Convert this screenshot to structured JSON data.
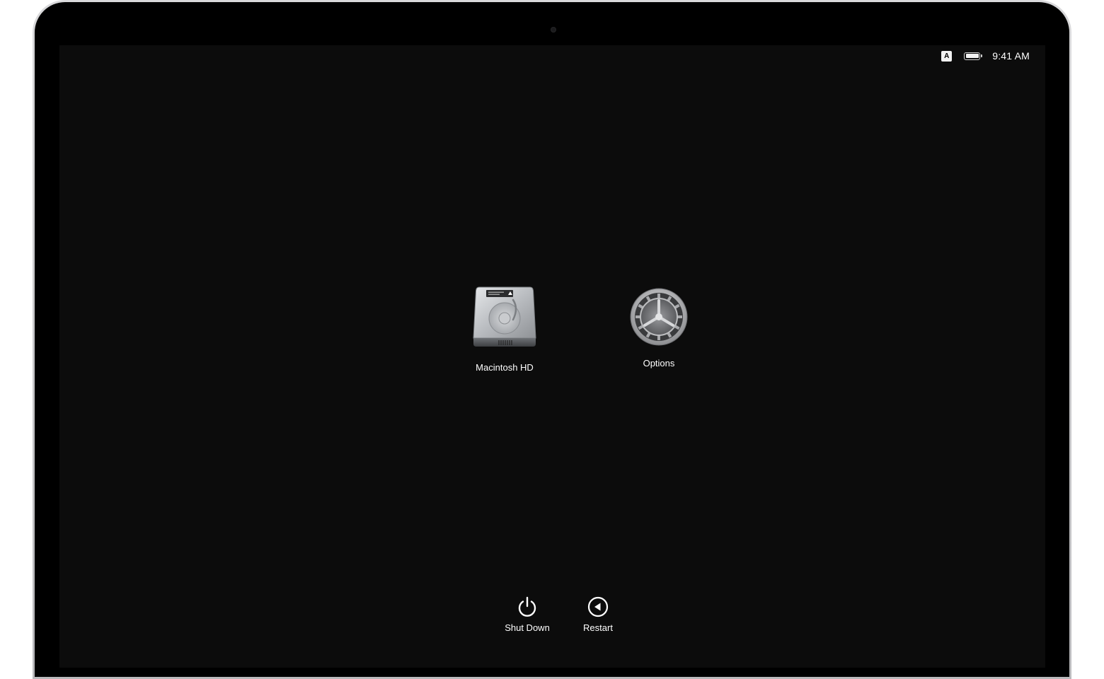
{
  "status_bar": {
    "input_source": "A",
    "time": "9:41 AM",
    "battery_level": 1.0
  },
  "volumes": [
    {
      "label": "Macintosh HD",
      "icon": "hard-drive-icon"
    },
    {
      "label": "Options",
      "icon": "gear-icon"
    }
  ],
  "actions": [
    {
      "label": "Shut Down",
      "icon": "power-icon"
    },
    {
      "label": "Restart",
      "icon": "restart-icon"
    }
  ],
  "colors": {
    "screen_background": "#0c0c0c",
    "text": "#ffffff"
  }
}
